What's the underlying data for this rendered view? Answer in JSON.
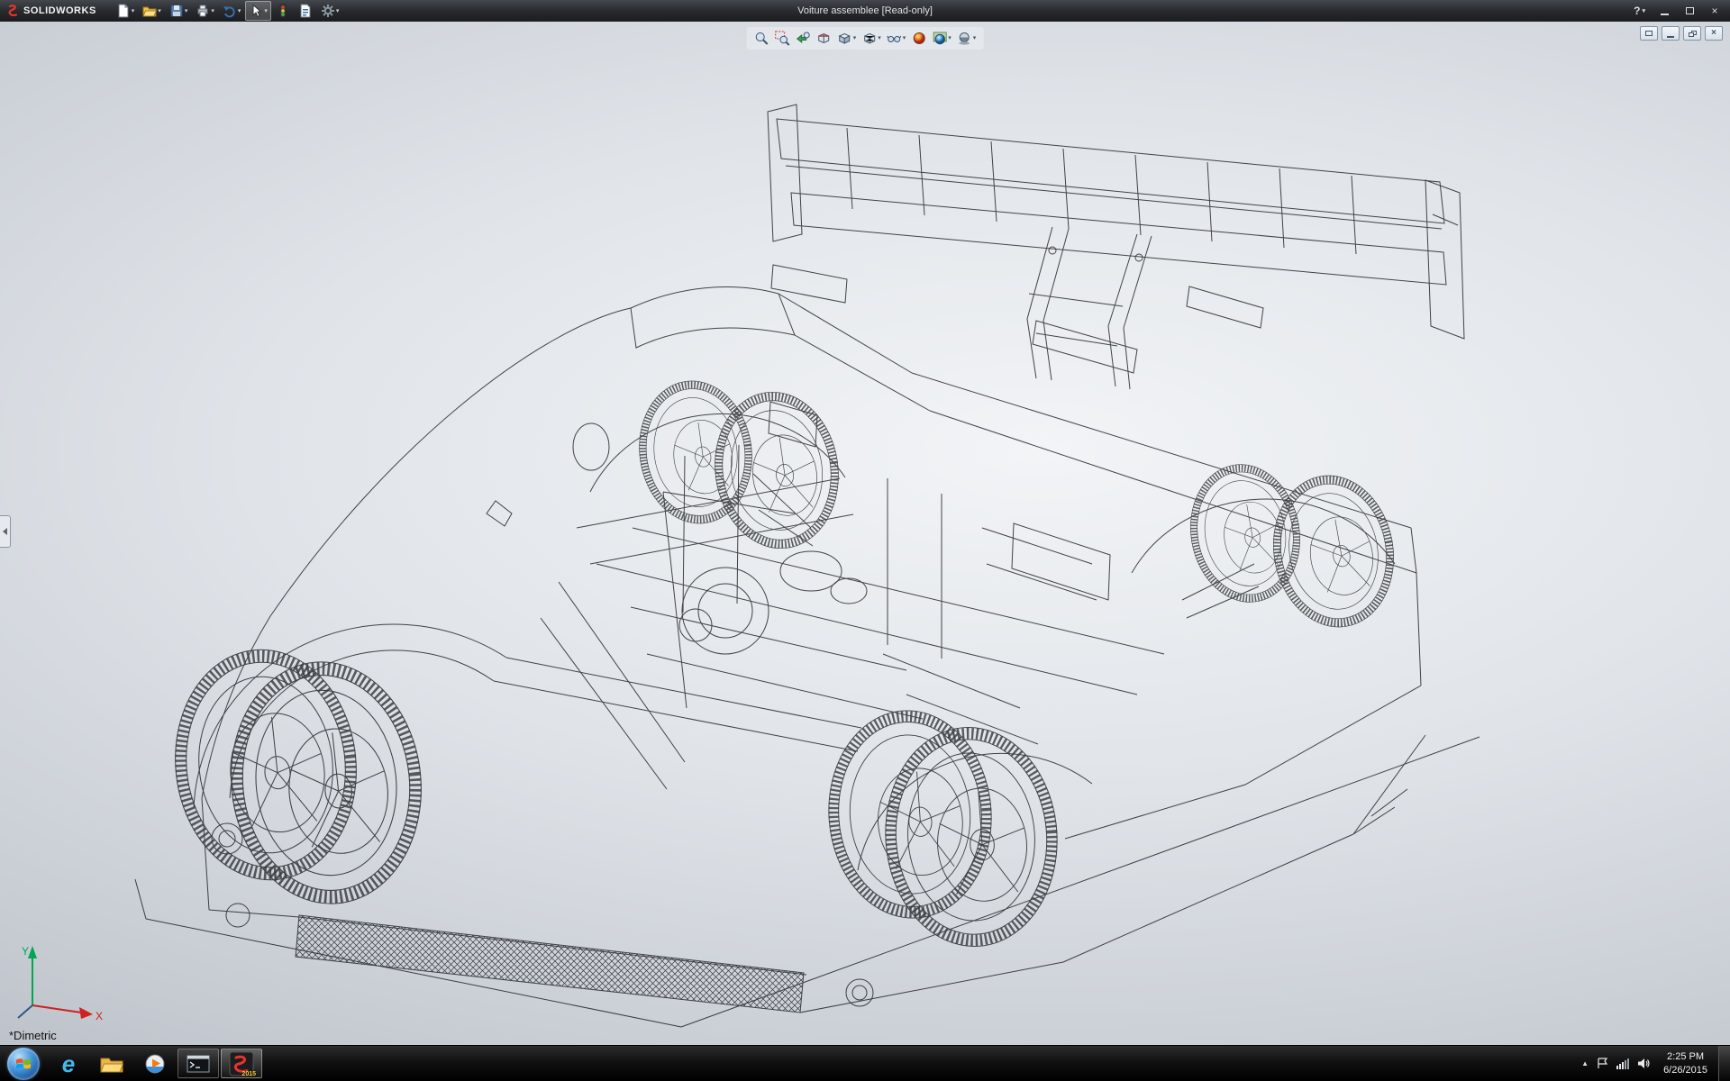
{
  "titlebar": {
    "brand": "SOLIDWORKS",
    "title": "Voiture assemblee [Read-only]",
    "help_label": "?",
    "tools": [
      "new",
      "open",
      "save",
      "print",
      "undo",
      "select",
      "rebuild",
      "file-properties",
      "options"
    ],
    "window_buttons": [
      "minimize",
      "maximize",
      "close"
    ]
  },
  "headsup_toolbar": {
    "tools": [
      "zoom-to-fit",
      "zoom-to-area",
      "previous-view",
      "section-view",
      "view-orientation",
      "display-style",
      "hide-show-items",
      "edit-appearance",
      "apply-scene",
      "view-settings"
    ]
  },
  "document_window_buttons": [
    "select-window",
    "minimize",
    "restore",
    "close"
  ],
  "viewport": {
    "orientation_label": "*Dimetric",
    "triad": {
      "x_label": "X",
      "y_label": "Y"
    }
  },
  "taskbar": {
    "apps": [
      "internet-explorer",
      "windows-explorer",
      "windows-media-player",
      "command-prompt",
      "solidworks-2015"
    ],
    "solidworks_year_badge": "2015",
    "tray": {
      "time": "2:25 PM",
      "date": "6/26/2015"
    }
  },
  "colors": {
    "titlebar_bg": "#26282c",
    "viewport_light": "#f2f4f6",
    "viewport_dark": "#a6abb4",
    "taskbar_bg": "#111111",
    "triad_x": "#cc2222",
    "triad_y": "#00a651",
    "wireframe": "#1c1e22"
  }
}
